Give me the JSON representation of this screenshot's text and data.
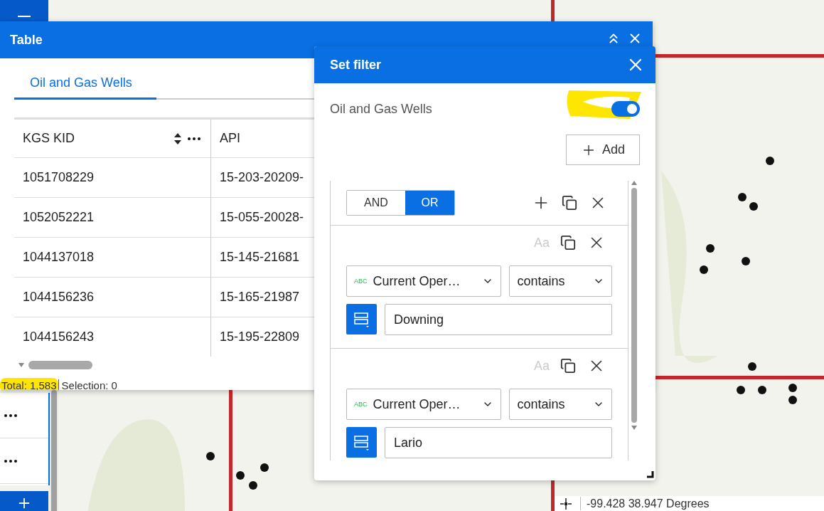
{
  "table_panel": {
    "title": "Table",
    "tabs": [
      {
        "label": "Oil and Gas Wells",
        "selected": true
      }
    ],
    "columns": [
      "KGS KID",
      "API"
    ],
    "rows": [
      [
        "1051708229",
        "15-203-20209-"
      ],
      [
        "1052052221",
        "15-055-20028-"
      ],
      [
        "1044137018",
        "15-145-21681"
      ],
      [
        "1044156236",
        "15-165-21987"
      ],
      [
        "1044156243",
        "15-195-22809"
      ]
    ],
    "total": {
      "text": "Total: 1,583",
      "highlighted": true
    },
    "selection": "Selection: 0"
  },
  "filter_panel": {
    "title": "Set filter",
    "layer": "Oil and Gas Wells",
    "enabled": true,
    "toggle_highlighted": true,
    "add_label": "Add",
    "logic": [
      {
        "label": "AND",
        "selected": false
      },
      {
        "label": "OR",
        "selected": true
      }
    ],
    "clauses": [
      {
        "case_label": "Aa",
        "field_type": "ABC",
        "field": "Current Oper…",
        "operator": "contains",
        "value": "Downing"
      },
      {
        "case_label": "Aa",
        "field_type": "ABC",
        "field": "Current Oper…",
        "operator": "contains",
        "value": "Lario"
      }
    ]
  },
  "coordinates": "-99.428 38.947 Degrees"
}
